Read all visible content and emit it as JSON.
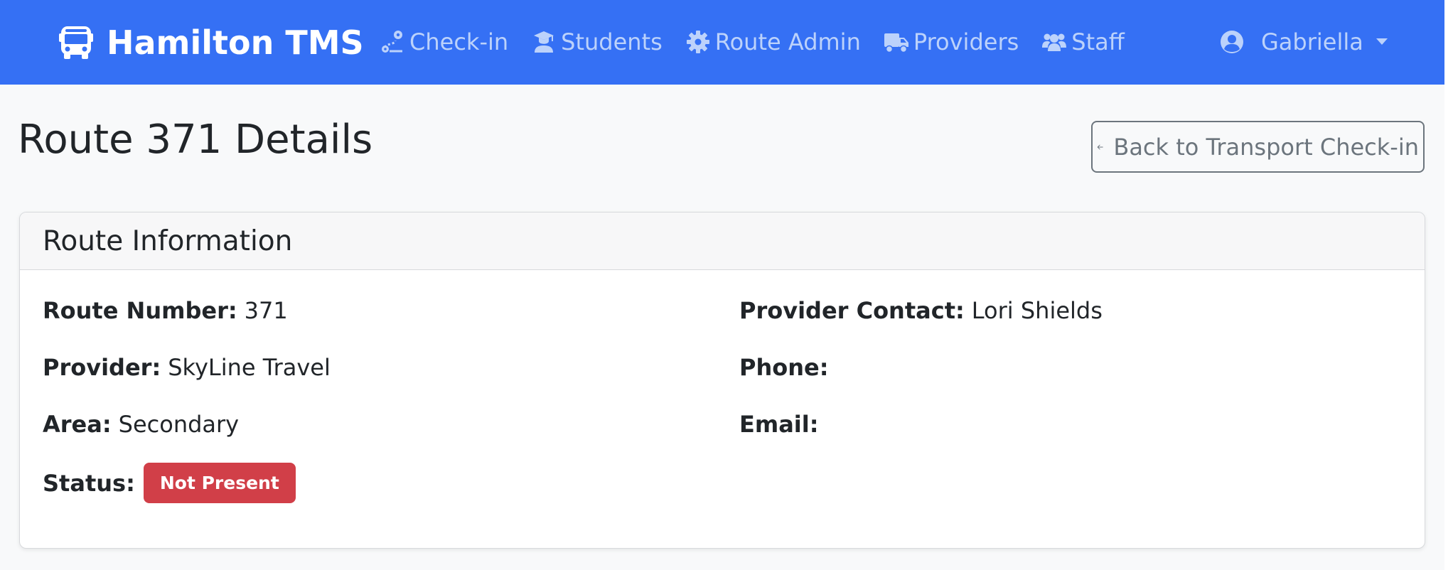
{
  "navbar": {
    "brand": "Hamilton TMS",
    "items": [
      {
        "label": "Check-in",
        "icon": "route-icon"
      },
      {
        "label": "Students",
        "icon": "graduate-icon"
      },
      {
        "label": "Route Admin",
        "icon": "gear-icon"
      },
      {
        "label": "Providers",
        "icon": "truck-icon"
      },
      {
        "label": "Staff",
        "icon": "users-icon"
      }
    ],
    "user": {
      "name": "Gabriella",
      "icon": "user-circle-icon"
    }
  },
  "colors": {
    "navbar_bg": "#3570f4",
    "nav_text": "#bcd2fb",
    "page_bg": "#f8f9fa",
    "status_badge": "#d13f48",
    "back_button_border": "#6c757d"
  },
  "page": {
    "title": "Route 371 Details",
    "back_button": {
      "label": "Back to Transport Check-in",
      "icon": "arrow-left-icon"
    }
  },
  "card": {
    "title": "Route Information",
    "left": [
      {
        "label": "Route Number:",
        "value": "371"
      },
      {
        "label": "Provider:",
        "value": "SkyLine Travel"
      },
      {
        "label": "Area:",
        "value": "Secondary"
      },
      {
        "label": "Status:",
        "value": "Not Present"
      }
    ],
    "right": [
      {
        "label": "Provider Contact:",
        "value": "Lori Shields"
      },
      {
        "label": "Phone:",
        "value": ""
      },
      {
        "label": "Email:",
        "value": ""
      }
    ]
  }
}
